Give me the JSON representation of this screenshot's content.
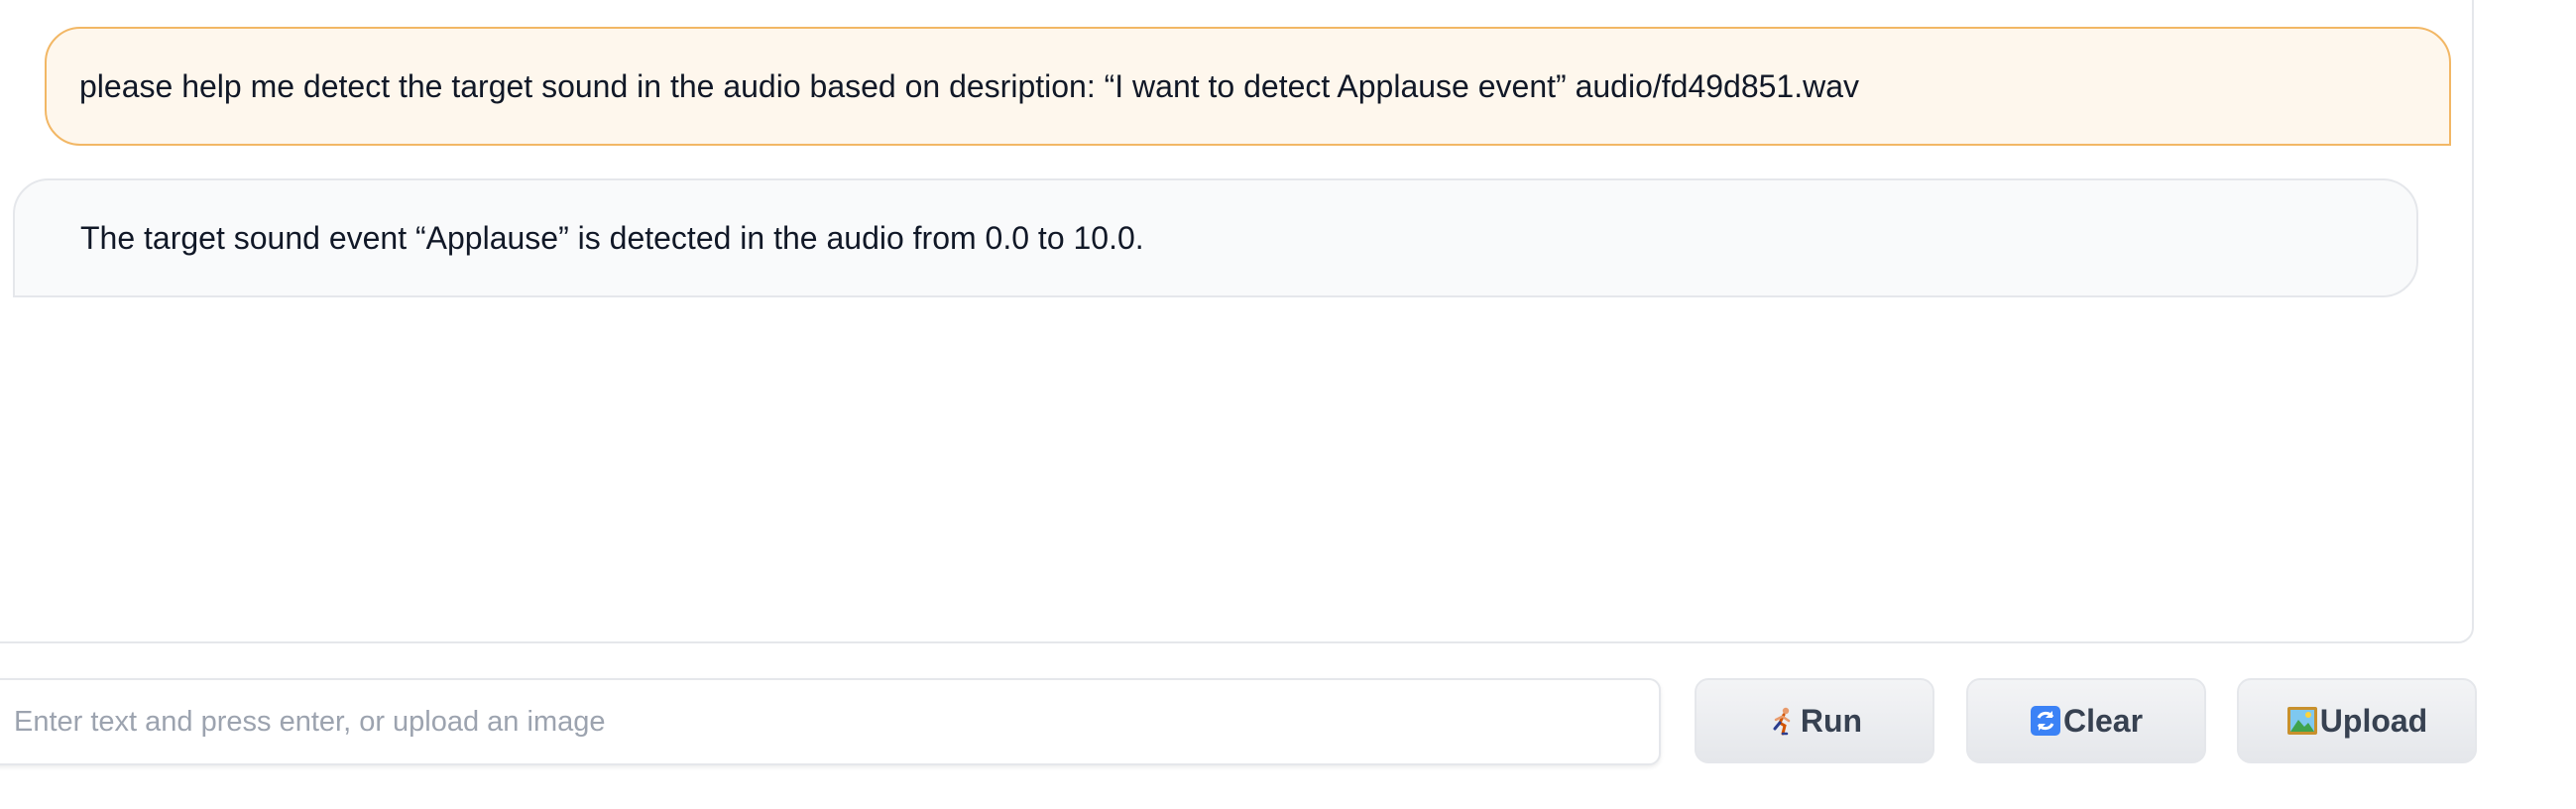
{
  "chat": {
    "messages": [
      {
        "role": "user",
        "text": "please help me detect the target sound in the audio based on desription: “I want to detect Applause event” audio/fd49d851.wav"
      },
      {
        "role": "assistant",
        "text": "The target sound event “Applause” is detected in the audio from 0.0 to 10.0."
      }
    ]
  },
  "input": {
    "placeholder": "Enter text and press enter, or upload an image",
    "value": ""
  },
  "buttons": {
    "run": {
      "label": "Run",
      "icon": "running-person-icon"
    },
    "clear": {
      "label": "Clear",
      "icon": "refresh-icon"
    },
    "upload": {
      "label": "Upload",
      "icon": "framed-picture-icon"
    }
  },
  "colors": {
    "user_bubble_bg": "#fef7ed",
    "user_bubble_border": "#f2b765",
    "bot_bubble_bg": "#f9fafb",
    "button_bg": "#f3f4f6"
  }
}
